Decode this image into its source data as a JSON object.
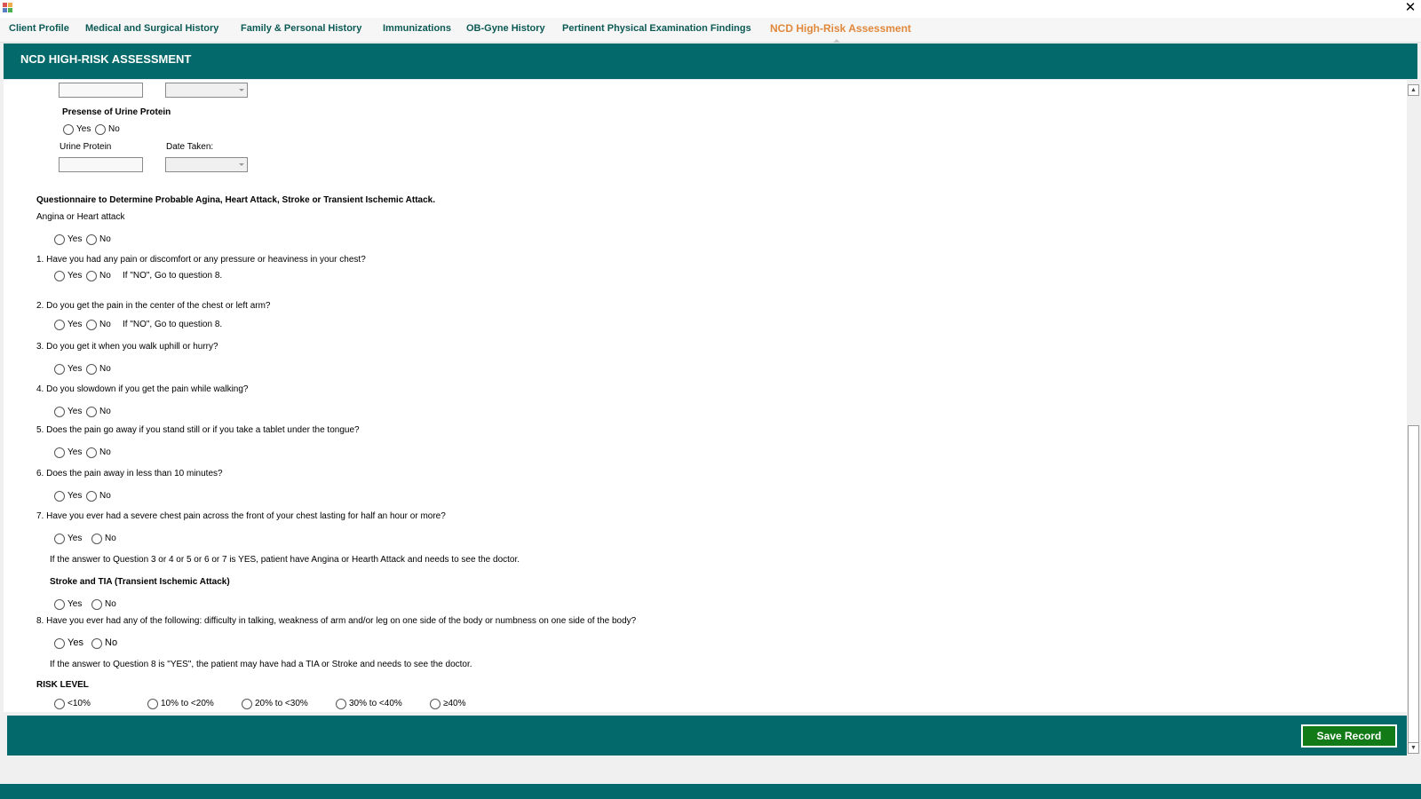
{
  "window": {
    "close_glyph": "✕",
    "app_icon": "app-icon"
  },
  "tabs": [
    {
      "label": "Client Profile"
    },
    {
      "label": "Medical and Surgical History"
    },
    {
      "label": "Family & Personal History"
    },
    {
      "label": "Immunizations"
    },
    {
      "label": "OB-Gyne History"
    },
    {
      "label": "Pertinent Physical Examination Findings"
    },
    {
      "label": "NCD High-Risk Assessment",
      "active": true
    }
  ],
  "header": {
    "title": "NCD HIGH-RISK ASSESSMENT"
  },
  "urine": {
    "heading": "Presense of Urine Protein",
    "yes": "Yes",
    "no": "No",
    "protein_label": "Urine Protein",
    "date_label": "Date Taken:"
  },
  "questionnaire": {
    "heading": "Questionnaire to Determine Probable Agina, Heart Attack, Stroke or Transient Ischemic Attack.",
    "angina_label": "Angina or Heart attack",
    "yes": "Yes",
    "no": "No",
    "q1": "1. Have you had any pain or discomfort or any pressure or heaviness in your chest?",
    "q1_note": "If \"NO\", Go to question 8.",
    "q2": "2. Do you get the pain in the center of the chest or left arm?",
    "q2_note": "If \"NO\", Go to question 8.",
    "q3": "3. Do you get it when you walk uphill or hurry?",
    "q4": "4. Do you slowdown if you get the pain while walking?",
    "q5": "5. Does the pain go away if you stand still or if you take a tablet under the tongue?",
    "q6": "6. Does the pain away in less than 10 minutes?",
    "q7": "7. Have you ever had a severe chest pain across the front of your chest lasting for half an hour or more?",
    "angina_note": "If the answer to Question 3 or 4 or 5 or 6 or 7 is YES, patient have Angina or Hearth Attack and needs to see the doctor.",
    "stroke_heading": "Stroke and TIA (Transient Ischemic Attack)",
    "q8": "8. Have you ever had any of the following:  difficulty in talking, weakness of arm and/or leg on one side of the body or numbness on one side of the body?",
    "stroke_note": "If the answer to Question 8 is \"YES\", the patient may have had a TIA or Stroke and needs to see the doctor."
  },
  "risk": {
    "heading": "RISK LEVEL",
    "options": [
      "<10%",
      "10% to <20%",
      "20% to <30%",
      "30% to <40%",
      "≥40%"
    ]
  },
  "footer": {
    "save_label": "Save Record"
  },
  "colors": {
    "header": "#04696a",
    "active_tab": "#e0883c",
    "tab_text": "#0c5a55",
    "save_button": "#127b17"
  }
}
